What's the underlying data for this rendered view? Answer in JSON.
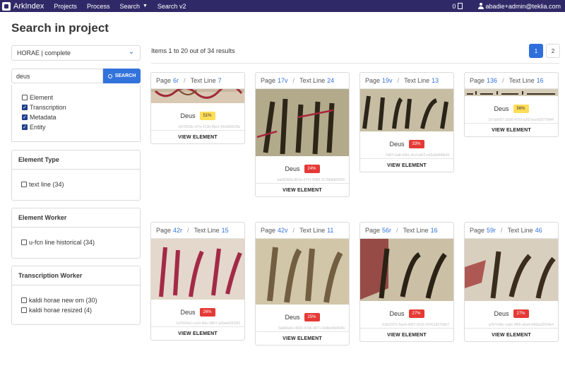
{
  "nav": {
    "brand": "ArkIndex",
    "items": [
      "Projects",
      "Process",
      "Search",
      "Search v2"
    ],
    "count": "0",
    "user": "abadie+admin@teklia.com"
  },
  "page_title": "Search in project",
  "project_select": "HORAE | complete",
  "search": {
    "value": "deus",
    "button": "SEARCH"
  },
  "sources": [
    {
      "label": "Element",
      "checked": false
    },
    {
      "label": "Transcription",
      "checked": true
    },
    {
      "label": "Metadata",
      "checked": true
    },
    {
      "label": "Entity",
      "checked": true
    }
  ],
  "facets": {
    "element_type": {
      "title": "Element Type",
      "options": [
        "text line (34)"
      ]
    },
    "element_worker": {
      "title": "Element Worker",
      "options": [
        "u-fcn line historical (34)"
      ]
    },
    "transcription_worker": {
      "title": "Transcription Worker",
      "options": [
        "kaldi horae new om (30)",
        "kaldi horae resized (4)"
      ]
    }
  },
  "results_summary": "Items 1 to 20 out of 34 results",
  "pagination": [
    "1",
    "2"
  ],
  "view_label": "VIEW ELEMENT",
  "page_label": "Page",
  "line_label": "Text Line",
  "colors": {
    "navbar": "#2f2a67",
    "primary": "#3273dc",
    "badge_red": "#e53935",
    "badge_yellow": "#ffdd57"
  },
  "cards": [
    {
      "page": "6r",
      "line": "7",
      "text": "Deus",
      "score": "51%",
      "level": "yellow",
      "uid": "b07831fe-1f7e-413b-9be1-5fc9d0203fa"
    },
    {
      "page": "17v",
      "line": "24",
      "text": "Deus",
      "score": "24%",
      "level": "red",
      "uid": "ba08365b-863e-4741-9986-1178b8d69299"
    },
    {
      "page": "19v",
      "line": "13",
      "text": "Deus",
      "score": "33%",
      "level": "red",
      "uid": "7a87c1a8-93b1-4ccf-af22-ed2a8d6f9b28"
    },
    {
      "page": "136",
      "line": "16",
      "text": "Deus",
      "score": "56%",
      "level": "yellow",
      "uid": "107ad087-2b56-4750-a3f2-bce9397784f4"
    },
    {
      "page": "42r",
      "line": "15",
      "text": "Deus",
      "score": "26%",
      "level": "red",
      "uid": "1e2524a1-cce0-4fac-9807-a6beb290183"
    },
    {
      "page": "42v",
      "line": "11",
      "text": "Deus",
      "score": "25%",
      "level": "red",
      "uid": "5a66ba6c-4682-47d6-9871-0e8be6fe834b"
    },
    {
      "page": "56r",
      "line": "16",
      "text": "Deus",
      "score": "27%",
      "level": "red",
      "uid": "61b0237c-5ae6-4857-9102-824116070b57"
    },
    {
      "page": "59r",
      "line": "46",
      "text": "Deus",
      "score": "27%",
      "level": "red",
      "uid": "a7b7e9bc-ca6c-4f56-a6a4-d46ba05f19e4"
    }
  ]
}
